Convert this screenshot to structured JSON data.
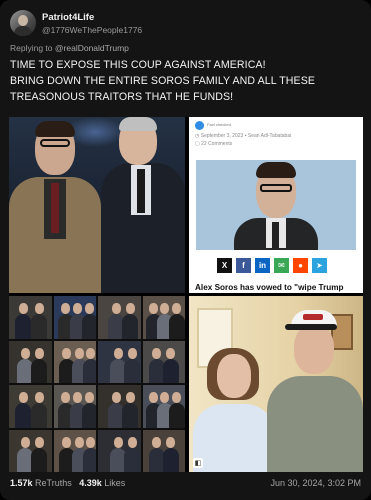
{
  "post": {
    "display_name": "Patriot4Life",
    "handle": "@1776WeThePeople1776",
    "reply_prefix": "Replying to",
    "reply_to": "@realDonaldTrump",
    "text_lines": [
      "TIME TO EXPOSE THIS COUP AGAINST AMERICA!",
      "BRING DOWN THE ENTIRE SOROS FAMILY AND ALL THESE",
      "TREASONOUS TRAITORS THAT HE FUNDS!"
    ]
  },
  "media": {
    "article": {
      "badge_label": "Fact checked",
      "date": "September 3, 2023",
      "author": "Sean Adl-Tabatabai",
      "comments": "22 Comments",
      "headline": "Alex Soros has vowed to \"wipe Trump",
      "share_buttons": [
        {
          "icon": "x-icon",
          "glyph": "X",
          "color": "#111111"
        },
        {
          "icon": "facebook-icon",
          "glyph": "f",
          "color": "#3b5998"
        },
        {
          "icon": "linkedin-icon",
          "glyph": "in",
          "color": "#0a66c2"
        },
        {
          "icon": "email-icon",
          "glyph": "✉",
          "color": "#3aa757"
        },
        {
          "icon": "reddit-icon",
          "glyph": "●",
          "color": "#ff4500"
        },
        {
          "icon": "telegram-icon",
          "glyph": "➤",
          "color": "#2aa3df"
        }
      ]
    }
  },
  "footer": {
    "retruths_count": "1.57k",
    "retruths_label": "ReTruths",
    "likes_count": "4.39k",
    "likes_label": "Likes",
    "timestamp": "Jun 30, 2024, 3:02 PM"
  },
  "colors": {
    "background": "#000000",
    "card": "#141414",
    "text": "#e7e9ea",
    "muted": "#9a9a9a"
  }
}
